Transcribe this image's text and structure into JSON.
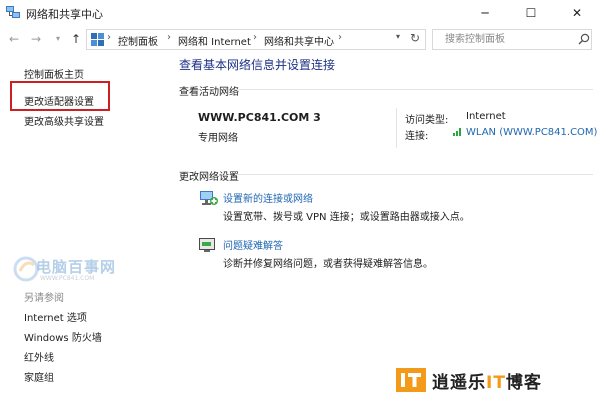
{
  "window": {
    "title": "网络和共享中心",
    "min_glyph": "─",
    "max_glyph": "☐",
    "close_glyph": "✕"
  },
  "nav": {
    "back_glyph": "←",
    "forward_glyph": "→",
    "recent_glyph": "▾",
    "up_glyph": "↑",
    "breadcrumb": [
      "控制面板",
      "网络和 Internet",
      "网络和共享中心"
    ],
    "breadcrumb_sep": "›",
    "dropdown_glyph": "▾",
    "refresh_glyph": "↻",
    "search_placeholder": "搜索控制面板"
  },
  "sidebar": {
    "items": [
      {
        "label": "控制面板主页"
      },
      {
        "label": "更改适配器设置"
      },
      {
        "label": "更改高级共享设置"
      }
    ],
    "see_also_title": "另请参阅",
    "see_also": [
      {
        "label": "Internet 选项"
      },
      {
        "label": "Windows 防火墙"
      },
      {
        "label": "红外线"
      },
      {
        "label": "家庭组"
      }
    ]
  },
  "main": {
    "title": "查看基本网络信息并设置连接",
    "active_header": "查看活动网络",
    "network_name": "WWW.PC841.COM  3",
    "network_type": "专用网络",
    "access_type_label": "访问类型:",
    "access_type_value": "Internet",
    "connection_label": "连接:",
    "connection_value": "WLAN (WWW.PC841.COM)",
    "change_header": "更改网络设置",
    "tasks": [
      {
        "link": "设置新的连接或网络",
        "desc": "设置宽带、拨号或 VPN 连接；或设置路由器或接入点。"
      },
      {
        "link": "问题疑难解答",
        "desc": "诊断并修复网络问题，或者获得疑难解答信息。"
      }
    ]
  },
  "watermarks": {
    "left_text": "电脑百事网",
    "left_sub": "WWW.PC841.COM",
    "right_pre": "逍遥乐",
    "right_it": "IT",
    "right_post": "博客"
  },
  "colors": {
    "link": "#1f67b1",
    "title": "#1e3287",
    "highlight": "#cc1f1f",
    "wifi": "#2aa640"
  }
}
